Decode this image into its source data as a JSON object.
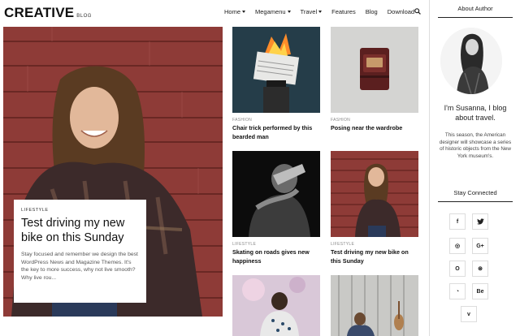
{
  "header": {
    "logo_main": "CREATIVE",
    "logo_sub": "BLOG"
  },
  "nav": {
    "items": [
      {
        "label": "Home",
        "dropdown": true
      },
      {
        "label": "Megamenu",
        "dropdown": true
      },
      {
        "label": "Travel",
        "dropdown": true
      },
      {
        "label": "Features",
        "dropdown": false
      },
      {
        "label": "Blog",
        "dropdown": false
      },
      {
        "label": "Download",
        "dropdown": false
      }
    ],
    "search_icon": "search-icon"
  },
  "hero": {
    "prev": "‹",
    "next": "›",
    "category": "LIFESTYLE",
    "title": "Test driving my new bike on this Sunday",
    "excerpt": "Stay focused and remember we design the best WordPress News and Magazine Themes. It's the key to more success, why not live smooth? Why live rou..."
  },
  "posts": [
    {
      "category": "FASHION",
      "title": "Chair trick performed by this bearded man"
    },
    {
      "category": "FASHION",
      "title": "Posing near the wardrobe"
    },
    {
      "category": "LIFESTYLE",
      "title": "Skating on roads gives new happiness"
    },
    {
      "category": "LIFESTYLE",
      "title": "Test driving my new bike on this Sunday"
    }
  ],
  "sidebar": {
    "about_heading": "About Author",
    "intro": "I'm Susanna, I blog about travel.",
    "description": "This season, the American designer will showcase a series of historic objects from the New York museum's.",
    "connected_heading": "Stay Connected",
    "social": [
      {
        "icon": "facebook-icon",
        "glyph": "f"
      },
      {
        "icon": "twitter-icon",
        "glyph": "🐦"
      },
      {
        "icon": "instagram-icon",
        "glyph": "◎"
      },
      {
        "icon": "googleplus-icon",
        "glyph": "G+"
      },
      {
        "icon": "opera-icon",
        "glyph": "O"
      },
      {
        "icon": "dribbble-icon",
        "glyph": "⊛"
      },
      {
        "icon": "rss-icon",
        "glyph": "◔"
      },
      {
        "icon": "behance-icon",
        "glyph": "Be"
      },
      {
        "icon": "vimeo-icon",
        "glyph": "v"
      }
    ]
  }
}
